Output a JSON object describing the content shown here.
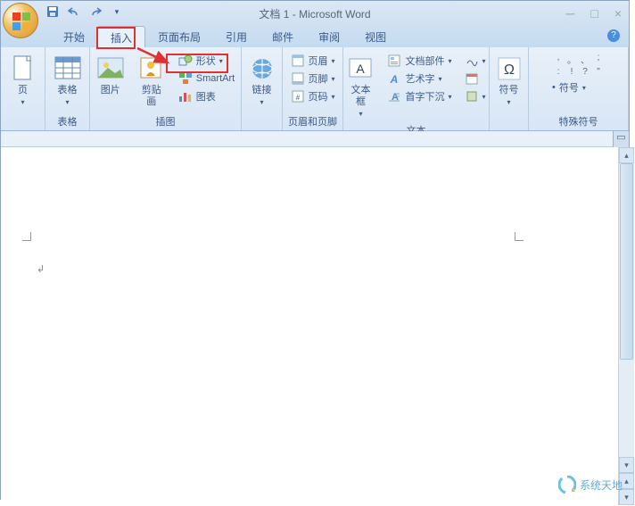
{
  "title": "文档 1 - Microsoft Word",
  "tabs": {
    "home": "开始",
    "insert": "插入",
    "layout": "页面布局",
    "references": "引用",
    "mail": "邮件",
    "review": "审阅",
    "view": "视图"
  },
  "groups": {
    "tables": "表格",
    "illustrations": "插图",
    "header_footer": "页眉和页脚",
    "text": "文本",
    "symbols": "特殊符号"
  },
  "buttons": {
    "page": "页",
    "table": "表格",
    "picture": "图片",
    "clipart": "剪贴画",
    "shapes": "形状",
    "smartart": "SmartArt",
    "chart": "图表",
    "link": "链接",
    "header": "页眉",
    "footer": "页脚",
    "page_number": "页码",
    "textbox": "文本框",
    "quick_parts": "文档部件",
    "wordart": "艺术字",
    "drop_cap": "首字下沉",
    "symbol": "符号",
    "symbol_row": "符号"
  },
  "watermark": "系统天地",
  "colors": {
    "annotation": "#e03030",
    "ribbon_bg": "#e8f0f9",
    "accent": "#3a5a8a"
  }
}
